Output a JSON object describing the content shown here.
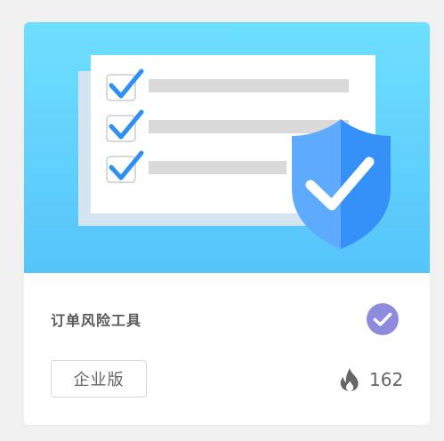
{
  "product": {
    "title": "订单风险工具",
    "edition_label": "企业版",
    "hot_count": "162"
  },
  "icons": {
    "banner": "checklist-with-shield-illustration",
    "verified": "verified-check-icon",
    "hot": "flame-icon"
  },
  "colors": {
    "banner_top": "#6edfff",
    "banner_bottom": "#56c4f9",
    "check_blue": "#2e8ff5",
    "shield_light": "#5eaaff",
    "shield_dark": "#3590f8",
    "verified_badge": "#8e8bdc",
    "flame": "#666666"
  }
}
